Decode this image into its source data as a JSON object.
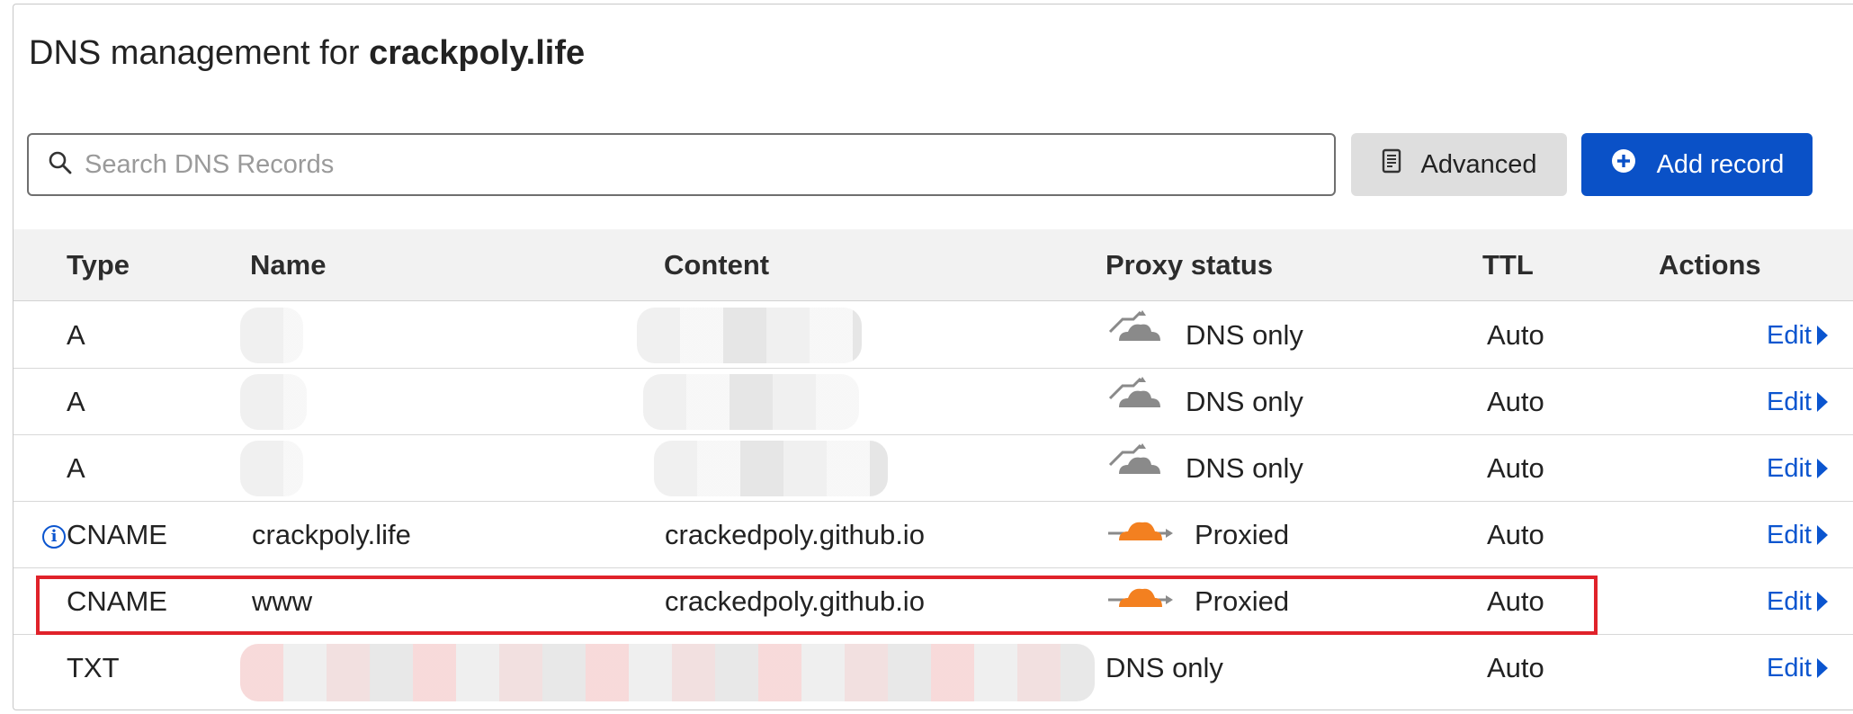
{
  "header": {
    "title_prefix": "DNS management for",
    "domain": "crackpoly.life"
  },
  "search": {
    "placeholder": "Search DNS Records",
    "value": ""
  },
  "toolbar": {
    "advanced_label": "Advanced",
    "add_record_label": "Add record"
  },
  "table": {
    "columns": [
      "Type",
      "Name",
      "Content",
      "Proxy status",
      "TTL",
      "Actions"
    ],
    "rows": [
      {
        "type": "A",
        "name": "",
        "content": "",
        "proxy": "DNS only",
        "proxy_icon": "dns-only-cloud-icon",
        "ttl": "Auto",
        "action": "Edit"
      },
      {
        "type": "A",
        "name": "",
        "content": "",
        "proxy": "DNS only",
        "proxy_icon": "dns-only-cloud-icon",
        "ttl": "Auto",
        "action": "Edit"
      },
      {
        "type": "A",
        "name": "",
        "content": "",
        "proxy": "DNS only",
        "proxy_icon": "dns-only-cloud-icon",
        "ttl": "Auto",
        "action": "Edit"
      },
      {
        "type": "CNAME",
        "name": "crackpoly.life",
        "content": "crackedpoly.github.io",
        "proxy": "Proxied",
        "proxy_icon": "proxied-cloud-icon",
        "ttl": "Auto",
        "action": "Edit"
      },
      {
        "type": "CNAME",
        "name": "www",
        "content": "crackedpoly.github.io",
        "proxy": "Proxied",
        "proxy_icon": "proxied-cloud-icon",
        "ttl": "Auto",
        "action": "Edit"
      },
      {
        "type": "TXT",
        "name": "",
        "content": "",
        "proxy": "DNS only",
        "proxy_icon": "",
        "ttl": "Auto",
        "action": "Edit"
      }
    ]
  },
  "colors": {
    "accent_blue": "#0a51c7",
    "proxied_orange": "#f38020",
    "dns_only_gray": "#8a8a8a",
    "highlight_red": "#e0222a"
  }
}
